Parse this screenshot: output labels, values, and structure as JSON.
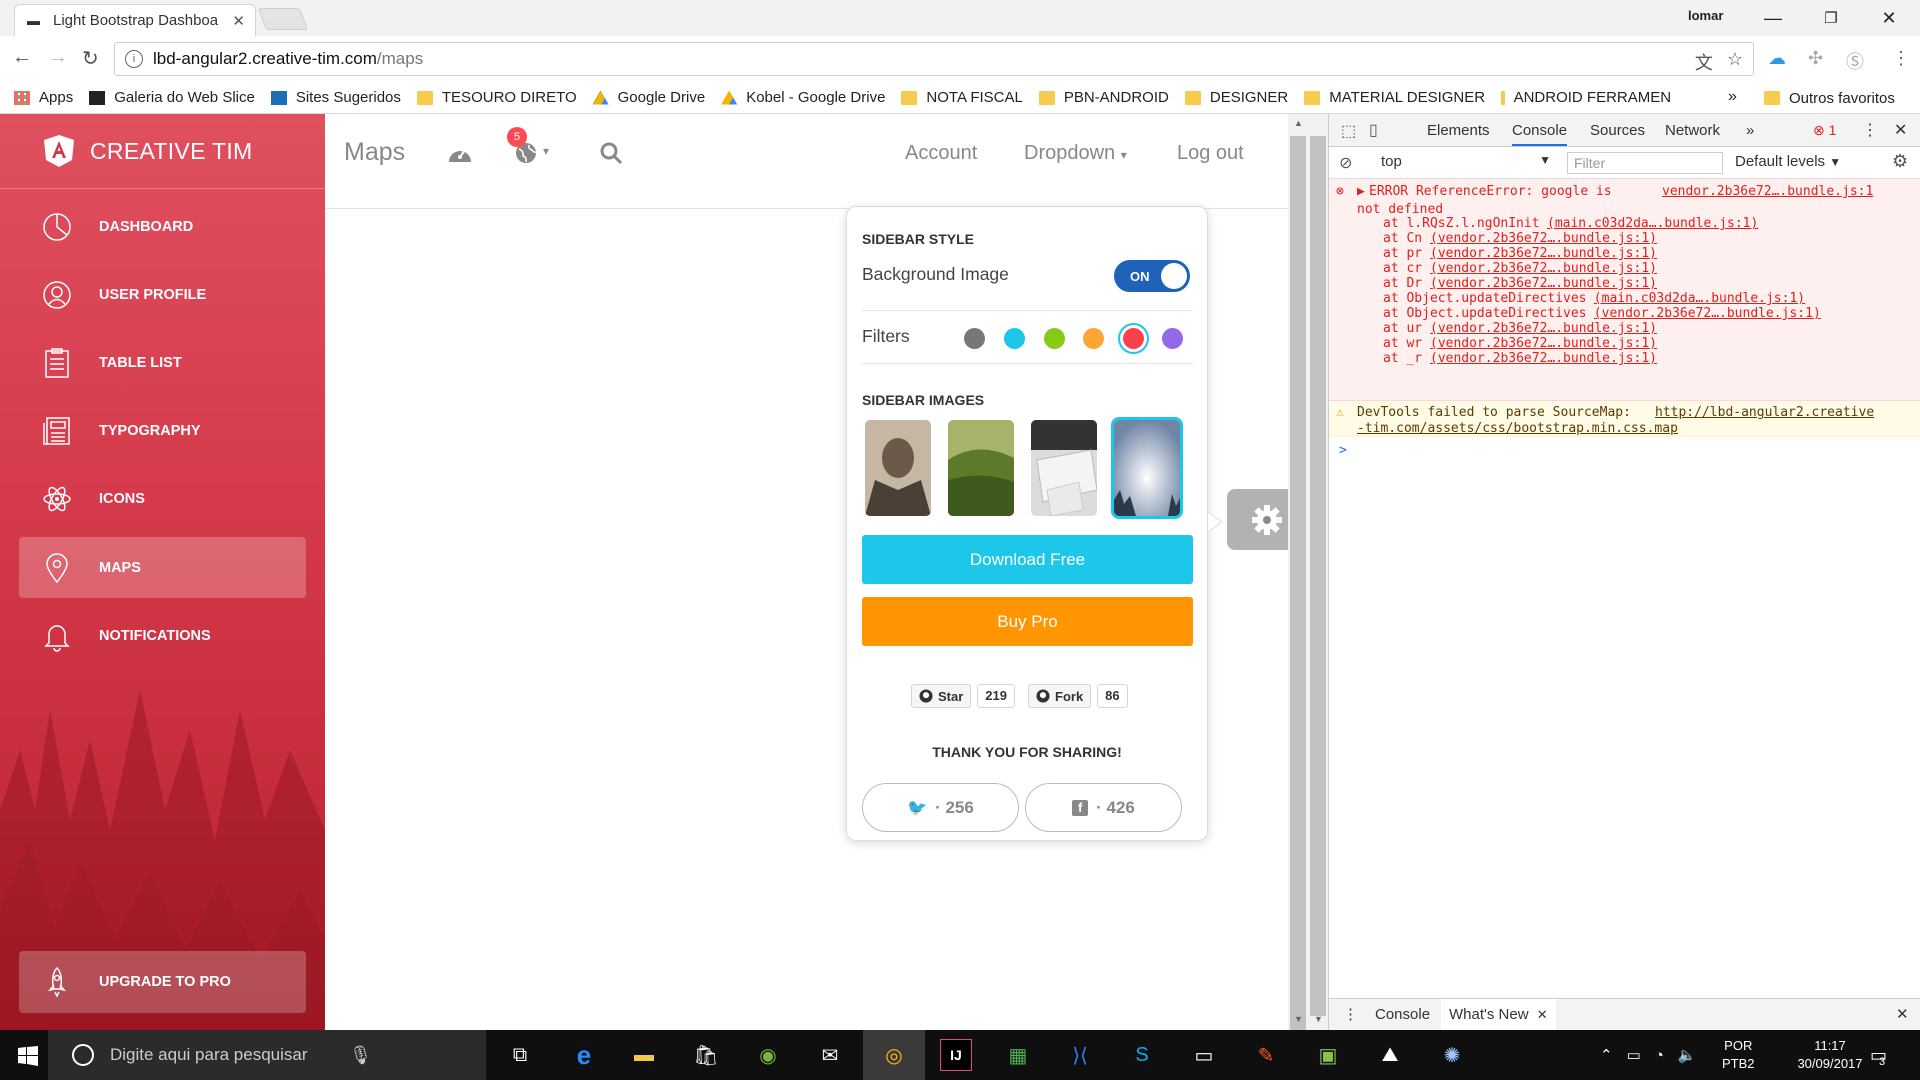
{
  "browser": {
    "tab_title": "Light Bootstrap Dashboa",
    "profile_name": "lomar",
    "url_host": "lbd-angular2.creative-tim.com",
    "url_path": "/maps",
    "bookmarks": [
      {
        "label": "Apps",
        "icon": "apps-grid-icon"
      },
      {
        "label": "Galeria do Web Slice",
        "icon": "web-slice-icon"
      },
      {
        "label": "Sites Sugeridos",
        "icon": "bing-icon"
      },
      {
        "label": "TESOURO DIRETO",
        "icon": "folder-icon"
      },
      {
        "label": "Google Drive",
        "icon": "drive-icon"
      },
      {
        "label": "Kobel - Google Drive",
        "icon": "drive-icon"
      },
      {
        "label": "NOTA FISCAL",
        "icon": "folder-icon"
      },
      {
        "label": "PBN-ANDROID",
        "icon": "folder-icon"
      },
      {
        "label": "DESIGNER",
        "icon": "folder-icon"
      },
      {
        "label": "MATERIAL DESIGNER",
        "icon": "folder-icon"
      },
      {
        "label": "ANDROID FERRAMEN",
        "icon": "folder-icon"
      }
    ],
    "bookmarks_more": "»",
    "other_bookmarks": "Outros favoritos"
  },
  "sidebar": {
    "brand": "CREATIVE TIM",
    "items": [
      {
        "label": "DASHBOARD",
        "icon": "pie-chart-icon"
      },
      {
        "label": "USER PROFILE",
        "icon": "user-icon"
      },
      {
        "label": "TABLE LIST",
        "icon": "clipboard-icon"
      },
      {
        "label": "TYPOGRAPHY",
        "icon": "news-icon"
      },
      {
        "label": "ICONS",
        "icon": "atom-icon"
      },
      {
        "label": "MAPS",
        "icon": "map-pin-icon",
        "active": true
      },
      {
        "label": "NOTIFICATIONS",
        "icon": "bell-icon"
      }
    ],
    "upgrade": "UPGRADE TO PRO",
    "colors": {
      "top": "#e0505f",
      "bottom": "#b8202c"
    }
  },
  "navbar": {
    "title": "Maps",
    "notification_count": "5",
    "links": {
      "account": "Account",
      "dropdown": "Dropdown",
      "logout": "Log out"
    }
  },
  "plugin": {
    "sidebar_style": "SIDEBAR STYLE",
    "background_image": "Background Image",
    "toggle_label": "ON",
    "filters": "Filters",
    "filter_colors": [
      "#777777",
      "#1dc7ea",
      "#87cb16",
      "#ffa534",
      "#fb404b",
      "#9368e9"
    ],
    "selected_filter": "#fb404b",
    "sidebar_images": "SIDEBAR IMAGES",
    "download_free": "Download Free",
    "buy_pro": "Buy Pro",
    "github": {
      "star": "Star",
      "star_count": "219",
      "fork": "Fork",
      "fork_count": "86"
    },
    "thank_you": "THANK YOU FOR SHARING!",
    "twitter_count": "· 256",
    "facebook_count": "· 426",
    "colors": {
      "download": "#1dc7ea",
      "buy": "#ff9500",
      "toggle": "#1e63b8"
    }
  },
  "devtools": {
    "tabs": [
      "Elements",
      "Console",
      "Sources",
      "Network"
    ],
    "active_tab": "Console",
    "more": "»",
    "error_count": "1",
    "context": "top",
    "filter_placeholder": "Filter",
    "levels": "Default levels",
    "error": {
      "message": "ERROR ReferenceError: google is",
      "message2": "not defined",
      "source": "vendor.2b36e72….bundle.js:1",
      "stack": [
        {
          "fn": "at l.RQsZ.l.ngOnInit",
          "file": "(main.c03d2da….bundle.js:1)"
        },
        {
          "fn": "at Cn",
          "file": "(vendor.2b36e72….bundle.js:1)"
        },
        {
          "fn": "at pr",
          "file": "(vendor.2b36e72….bundle.js:1)"
        },
        {
          "fn": "at cr",
          "file": "(vendor.2b36e72….bundle.js:1)"
        },
        {
          "fn": "at Dr",
          "file": "(vendor.2b36e72….bundle.js:1)"
        },
        {
          "fn": "at Object.updateDirectives",
          "file": "(main.c03d2da….bundle.js:1)"
        },
        {
          "fn": "at Object.updateDirectives",
          "file": "(vendor.2b36e72….bundle.js:1)"
        },
        {
          "fn": "at ur",
          "file": "(vendor.2b36e72….bundle.js:1)"
        },
        {
          "fn": "at wr",
          "file": "(vendor.2b36e72….bundle.js:1)"
        },
        {
          "fn": "at _r",
          "file": "(vendor.2b36e72….bundle.js:1)"
        }
      ]
    },
    "warning": {
      "text": "DevTools failed to parse SourceMap:",
      "link1": "http://lbd-angular2.creative",
      "link2": "-tim.com/assets/css/bootstrap.min.css.map"
    },
    "prompt": ">",
    "drawer_tabs": [
      "Console",
      "What's New"
    ],
    "colors": {
      "error": "#e0201c",
      "error_bg": "#fff0f0",
      "warn_bg": "#fffbe6"
    }
  },
  "taskbar": {
    "search_placeholder": "Digite aqui para pesquisar",
    "lang": "POR",
    "layout": "PTB2",
    "time": "11:17",
    "date": "30/09/2017",
    "notif_count": "3"
  }
}
